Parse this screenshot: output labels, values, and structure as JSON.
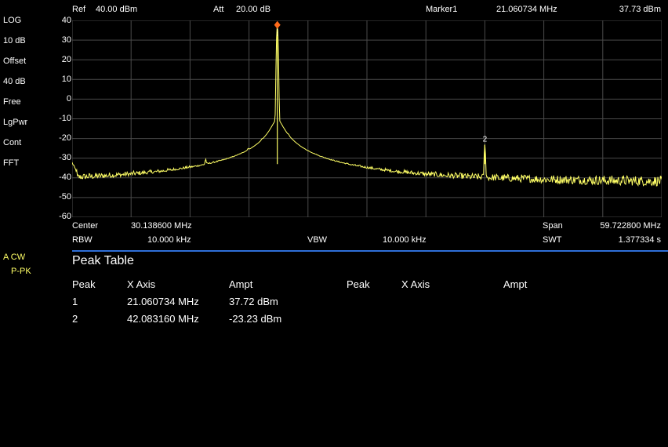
{
  "header": {
    "ref_label": "Ref",
    "ref_value": "40.00 dBm",
    "att_label": "Att",
    "att_value": "20.00 dB",
    "marker_label": "Marker1",
    "marker_freq": "21.060734 MHz",
    "marker_ampl": "37.73 dBm"
  },
  "left_panel": {
    "items": [
      "LOG",
      "10 dB",
      "Offset",
      "40 dB",
      "Free",
      "LgPwr",
      "Cont",
      "FFT"
    ],
    "trace_mode": "A CW",
    "detector": "P-PK"
  },
  "footer": {
    "center_label": "Center",
    "center_value": "30.138600 MHz",
    "span_label": "Span",
    "span_value": "59.722800 MHz",
    "rbw_label": "RBW",
    "rbw_value": "10.000 kHz",
    "vbw_label": "VBW",
    "vbw_value": "10.000 kHz",
    "swt_label": "SWT",
    "swt_value": "1.377334 s"
  },
  "peak_table": {
    "title": "Peak Table",
    "headers": [
      "Peak",
      "X Axis",
      "Ampt",
      "Peak",
      "X Axis",
      "Ampt"
    ],
    "rows": [
      {
        "peak": "1",
        "x": "21.060734 MHz",
        "ampt": "37.72 dBm"
      },
      {
        "peak": "2",
        "x": "42.083160 MHz",
        "ampt": "-23.23 dBm"
      }
    ]
  },
  "chart_data": {
    "type": "line",
    "x_unit": "MHz",
    "xlim": [
      0.2772,
      59.999999
    ],
    "ylim": [
      -60,
      40
    ],
    "y_ticks": [
      "40",
      "30",
      "20",
      "10",
      "0",
      "-10",
      "-20",
      "-30",
      "-40",
      "-50",
      "-60"
    ],
    "grid": true,
    "noise_floor_dbm": -43,
    "trace_color": "#ffff66",
    "peaks": [
      {
        "x_mhz": 21.060734,
        "ampl_dbm": 37.72,
        "label": "1"
      },
      {
        "x_mhz": 42.08316,
        "ampl_dbm": -23.23,
        "label": "2"
      }
    ],
    "spurs": [
      {
        "x_mhz": 13.8,
        "ampl_dbm": -34
      },
      {
        "x_mhz": 18.1,
        "ampl_dbm": -33
      },
      {
        "x_mhz": 19.5,
        "ampl_dbm": -30
      },
      {
        "x_mhz": 22.2,
        "ampl_dbm": -28
      }
    ],
    "marker_glyph": "2"
  }
}
